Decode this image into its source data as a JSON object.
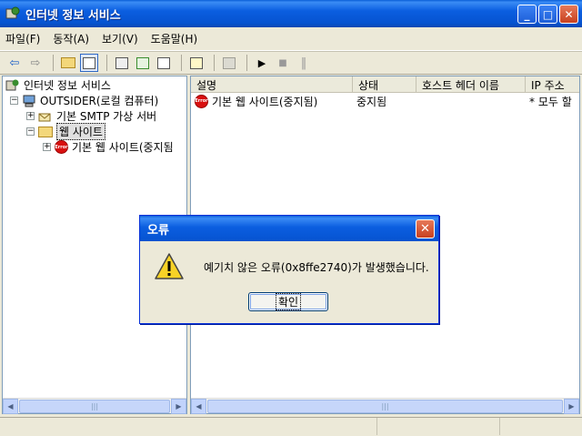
{
  "window": {
    "title": "인터넷 정보 서비스",
    "minimize": "_",
    "maximize": "□",
    "close": "✕"
  },
  "menu": [
    {
      "label": "파일(F)"
    },
    {
      "label": "동작(A)"
    },
    {
      "label": "보기(V)"
    },
    {
      "label": "도움말(H)"
    }
  ],
  "toolbar": {
    "back": "⇦",
    "forward": "⇨",
    "play": "▶",
    "stop": "■",
    "pause": "‖"
  },
  "tree": {
    "root": "인터넷 정보 서비스",
    "server": "OUTSIDER(로컬 컴퓨터)",
    "smtp": "기본 SMTP 가상 서버",
    "websites": "웹 사이트",
    "default_site": "기본 웹 사이트(중지됨",
    "stop_label": "Error"
  },
  "list": {
    "columns": [
      {
        "label": "설명"
      },
      {
        "label": "상태"
      },
      {
        "label": "호스트 헤더 이름"
      },
      {
        "label": "IP 주소"
      }
    ],
    "rows": [
      {
        "description": "기본 웹 사이트(중지됨)",
        "status": "중지됨",
        "host": "",
        "ip": "* 모두 할"
      }
    ]
  },
  "scroll": {
    "thumb": "|||"
  },
  "dialog": {
    "title": "오류",
    "message": "예기치 않은 오류(0x8ffe2740)가 발생했습니다.",
    "ok": "확인",
    "close": "✕"
  },
  "colors": {
    "accent": "#0a5fd8",
    "selection": "#316ac5",
    "error": "#d91010"
  }
}
